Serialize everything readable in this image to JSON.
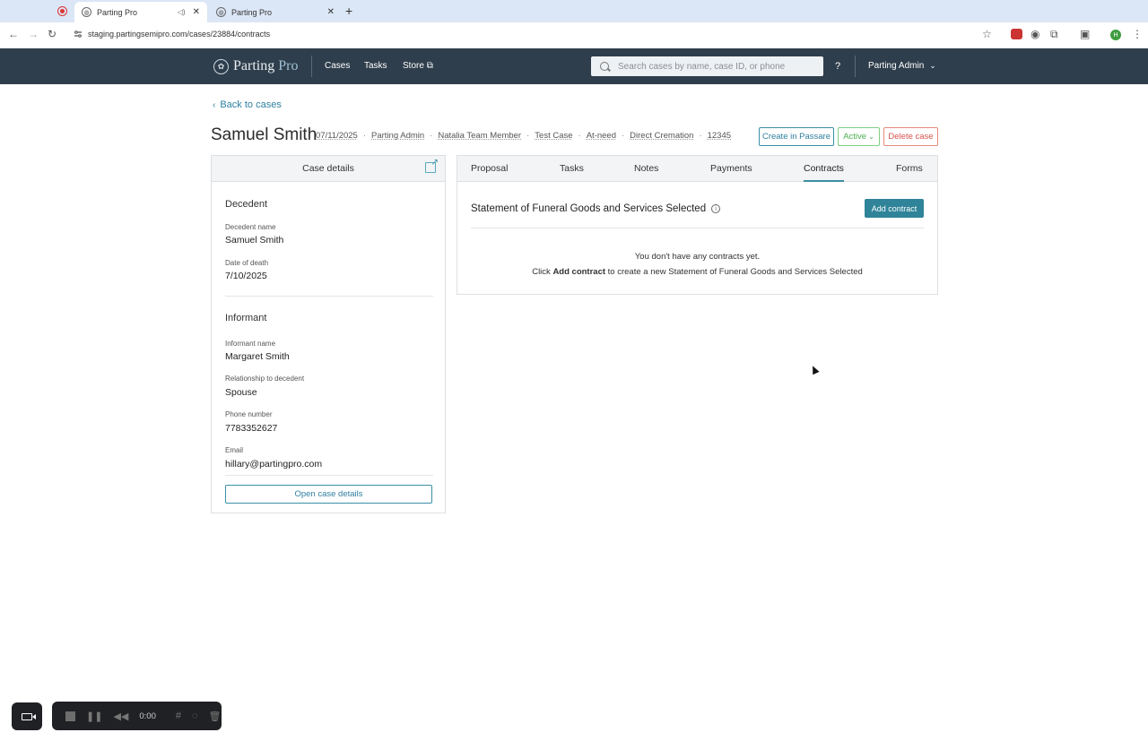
{
  "browser": {
    "tabs": [
      {
        "title": "Parting Pro",
        "active": true
      },
      {
        "title": "Parting Pro",
        "active": false
      }
    ],
    "url": "staging.partingsemipro.com/cases/23884/contracts",
    "profile_initial": "H"
  },
  "header": {
    "logo_parting": "Parting",
    "logo_pro": "Pro",
    "nav": [
      "Cases",
      "Tasks",
      "Store"
    ],
    "search_placeholder": "Search cases by name, case ID, or phone",
    "help": "?",
    "user": "Parting Admin"
  },
  "page": {
    "back_label": "Back to cases",
    "case_name": "Samuel Smith",
    "meta": [
      "07/11/2025",
      "Parting Admin",
      "Natalia Team Member",
      "Test Case",
      "At-need",
      "Direct Cremation",
      "12345"
    ],
    "actions": {
      "create_passare": "Create in Passare",
      "status": "Active",
      "delete": "Delete case"
    }
  },
  "case_details": {
    "title": "Case details",
    "decedent": {
      "heading": "Decedent",
      "name_label": "Decedent name",
      "name": "Samuel Smith",
      "dod_label": "Date of death",
      "dod": "7/10/2025"
    },
    "informant": {
      "heading": "Informant",
      "name_label": "Informant name",
      "name": "Margaret Smith",
      "rel_label": "Relationship to decedent",
      "rel": "Spouse",
      "phone_label": "Phone number",
      "phone": "7783352627",
      "email_label": "Email",
      "email": "hillary@partingpro.com"
    },
    "open_button": "Open case details"
  },
  "panel": {
    "tabs": [
      "Proposal",
      "Tasks",
      "Notes",
      "Payments",
      "Contracts",
      "Forms"
    ],
    "selected_tab": "Contracts",
    "section_title": "Statement of Funeral Goods and Services Selected",
    "add_button": "Add contract",
    "empty_line1": "You don't have any contracts yet.",
    "empty_line2_pre": "Click ",
    "empty_line2_bold": "Add contract",
    "empty_line2_post": " to create a new Statement of Funeral Goods and Services Selected"
  },
  "recorder": {
    "time": "0:00"
  }
}
